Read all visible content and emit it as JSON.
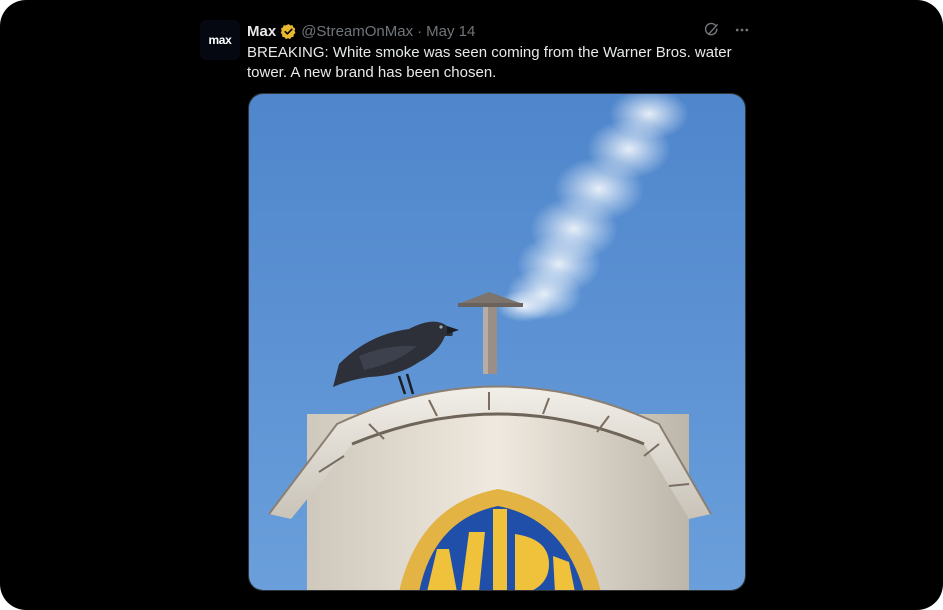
{
  "tweet": {
    "avatar_text": "max",
    "display_name": "Max",
    "handle": "@StreamOnMax",
    "separator": "·",
    "date": "May 14",
    "text": "BREAKING: White smoke was seen coming from the Warner Bros. water tower. A new brand has been chosen.",
    "icons": {
      "verified": "verified-gold-badge-icon",
      "grok": "grok-icon",
      "more": "more-icon"
    }
  },
  "media": {
    "description_icons": [
      "crow",
      "water-tower",
      "wb-shield",
      "smoke"
    ]
  },
  "colors": {
    "background": "#000000",
    "text": "#e7e9ea",
    "muted": "#71767b",
    "badge": "#e8b830",
    "sky": "#5b8fd0"
  }
}
